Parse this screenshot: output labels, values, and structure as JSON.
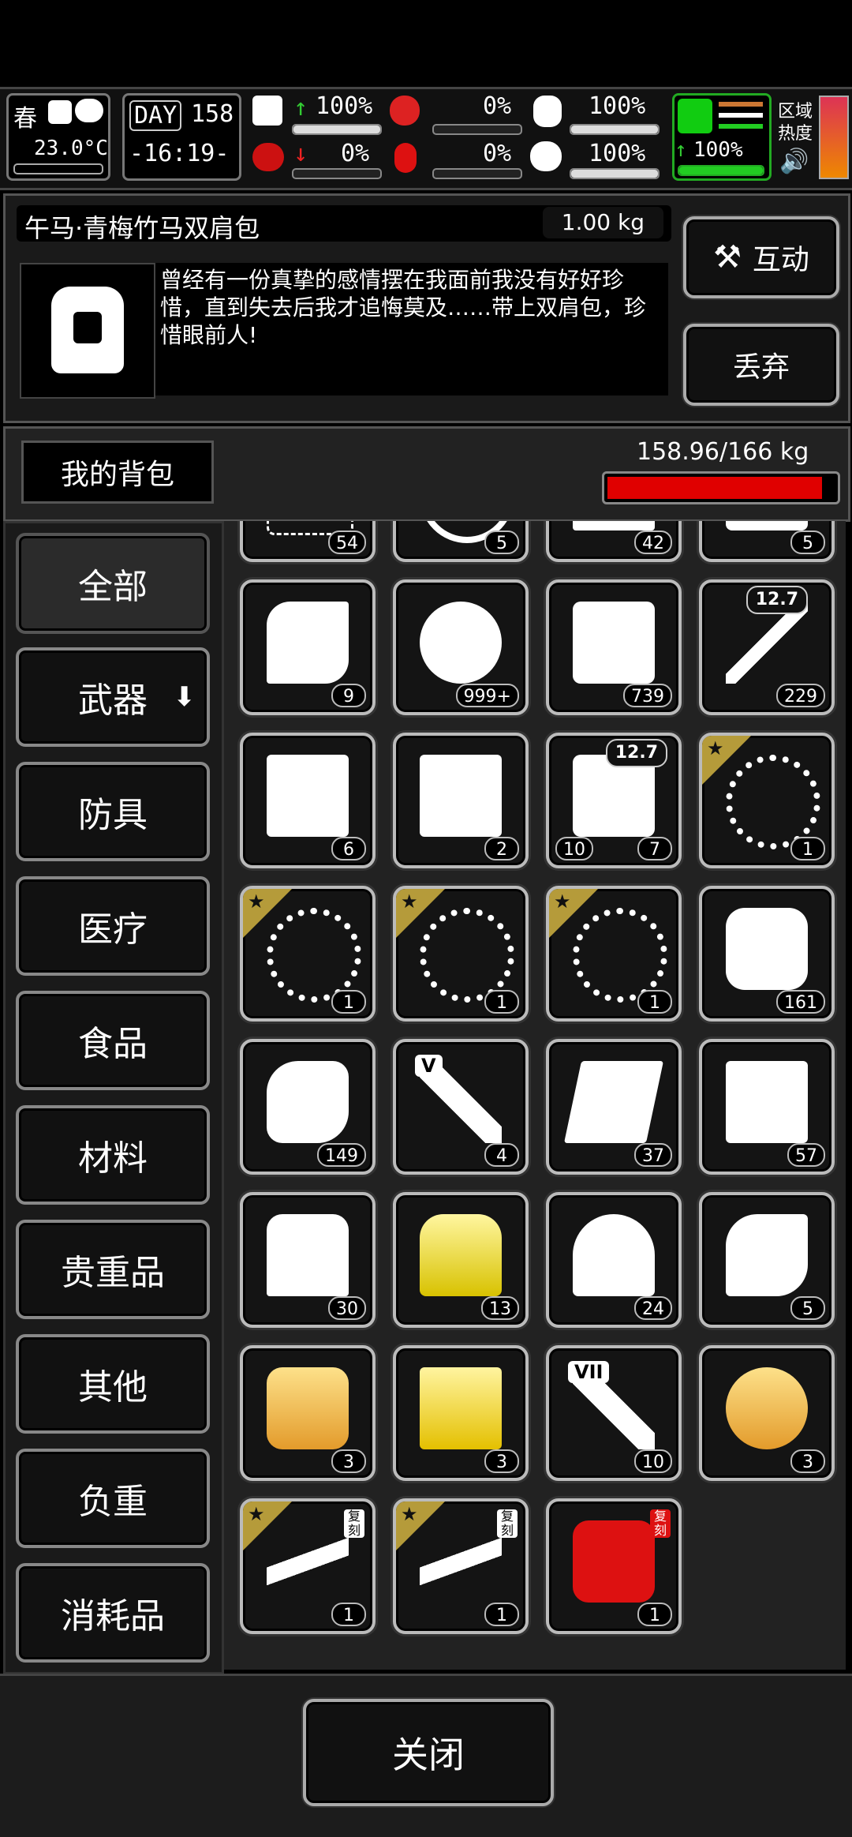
{
  "hud": {
    "season": "春",
    "temperature": "23.0°C",
    "day_label": "DAY",
    "day_value": "158",
    "time": "-16:19-",
    "stats": [
      {
        "name": "health",
        "value": "100%"
      },
      {
        "name": "hunger",
        "value": "0%"
      },
      {
        "name": "armor",
        "value": "100%"
      },
      {
        "name": "infection",
        "value": "0%"
      },
      {
        "name": "blood",
        "value": "0%"
      },
      {
        "name": "mood",
        "value": "100%"
      },
      {
        "name": "stamina",
        "value": "100%"
      }
    ],
    "area_heat_label_1": "区域",
    "area_heat_label_2": "热度"
  },
  "item": {
    "name": "午马·青梅竹马双肩包",
    "weight": "1.00 kg",
    "description": "曾经有一份真挚的感情摆在我面前我没有好好珍惜，直到失去后我才追悔莫及……带上双肩包，珍惜眼前人!"
  },
  "actions": {
    "interact": "互动",
    "discard": "丢弃"
  },
  "bag": {
    "label": "我的背包",
    "capacity": "158.96/166 kg",
    "fill_ratio": 0.9576
  },
  "categories": [
    "全部",
    "武器",
    "防具",
    "医疗",
    "食品",
    "材料",
    "贵重品",
    "其他",
    "负重",
    "消耗品"
  ],
  "slots": [
    {
      "icon": "net-icon",
      "qty": "54"
    },
    {
      "icon": "rope-icon",
      "qty": "5"
    },
    {
      "icon": "battery-icon",
      "qty": "42"
    },
    {
      "icon": "toolbox-icon",
      "qty": "5"
    },
    {
      "icon": "cloth-scrap-icon",
      "qty": "9"
    },
    {
      "icon": "coin-icon",
      "qty": "999+"
    },
    {
      "icon": "jerrycan-icon",
      "qty": "739"
    },
    {
      "icon": "bullet-icon",
      "qty": "229",
      "tag": "12.7"
    },
    {
      "icon": "crate-icon",
      "qty": "6"
    },
    {
      "icon": "crate-icon",
      "qty": "2"
    },
    {
      "icon": "ammo-box-icon",
      "qty": "7",
      "qty2": "10",
      "tag": "12.7"
    },
    {
      "icon": "whip-icon",
      "qty": "1",
      "star": true
    },
    {
      "icon": "whip-icon",
      "qty": "1",
      "star": true
    },
    {
      "icon": "whip-icon",
      "qty": "1",
      "star": true
    },
    {
      "icon": "whip-icon",
      "qty": "1",
      "star": true
    },
    {
      "icon": "towel-icon",
      "qty": "161"
    },
    {
      "icon": "sack-icon",
      "qty": "149"
    },
    {
      "icon": "test-tube-icon",
      "qty": "4",
      "label": "V"
    },
    {
      "icon": "fabric-icon",
      "qty": "37"
    },
    {
      "icon": "sheet-icon",
      "qty": "57"
    },
    {
      "icon": "torn-shirt-icon",
      "qty": "30"
    },
    {
      "icon": "crystal-icon",
      "qty": "13"
    },
    {
      "icon": "blanket-icon",
      "qty": "24"
    },
    {
      "icon": "paper-roll-icon",
      "qty": "5"
    },
    {
      "icon": "thread-spool-icon",
      "qty": "3"
    },
    {
      "icon": "gold-cloth-icon",
      "qty": "3"
    },
    {
      "icon": "test-tube-icon",
      "qty": "10",
      "label": "VII"
    },
    {
      "icon": "yarn-icon",
      "qty": "3"
    },
    {
      "icon": "rifle-icon",
      "qty": "1",
      "star": true,
      "badge": "复刻"
    },
    {
      "icon": "rifle-icon",
      "qty": "1",
      "star": true,
      "badge": "复刻"
    },
    {
      "icon": "red-weapon-icon",
      "qty": "1",
      "badge": "复刻"
    }
  ],
  "close_label": "关闭",
  "colors": {
    "capacity_bar": "#e00000",
    "star": "#b59b3a"
  }
}
